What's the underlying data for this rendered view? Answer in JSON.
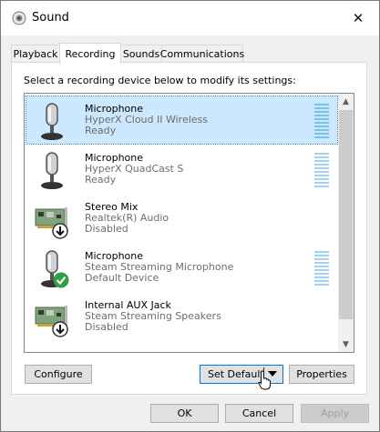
{
  "window": {
    "title": "Sound",
    "close": "✕"
  },
  "tabs": [
    {
      "label": "Playback"
    },
    {
      "label": "Recording"
    },
    {
      "label": "Sounds"
    },
    {
      "label": "Communications"
    }
  ],
  "instruction": "Select a recording device below to modify its settings:",
  "devices": [
    {
      "name": "Microphone",
      "description": "HyperX Cloud II Wireless",
      "state": "Ready",
      "icon": "microphone-icon",
      "selected": true
    },
    {
      "name": "Microphone",
      "description": "HyperX QuadCast S",
      "state": "Ready",
      "icon": "microphone-icon"
    },
    {
      "name": "Stereo Mix",
      "description": "Realtek(R) Audio",
      "state": "Disabled",
      "icon": "sound-card-icon"
    },
    {
      "name": "Microphone",
      "description": "Steam Streaming Microphone",
      "state": "Default Device",
      "icon": "microphone-icon"
    },
    {
      "name": "Internal AUX Jack",
      "description": "Steam Streaming Speakers",
      "state": "Disabled",
      "icon": "sound-card-icon"
    }
  ],
  "buttons": {
    "configure": "Configure",
    "set_default": "Set Default",
    "properties": "Properties",
    "ok": "OK",
    "cancel": "Cancel",
    "apply": "Apply"
  },
  "colors": {
    "selection": "#cce8ff",
    "level_meter": "#9ed3f5",
    "default_check": "#2ea043"
  }
}
